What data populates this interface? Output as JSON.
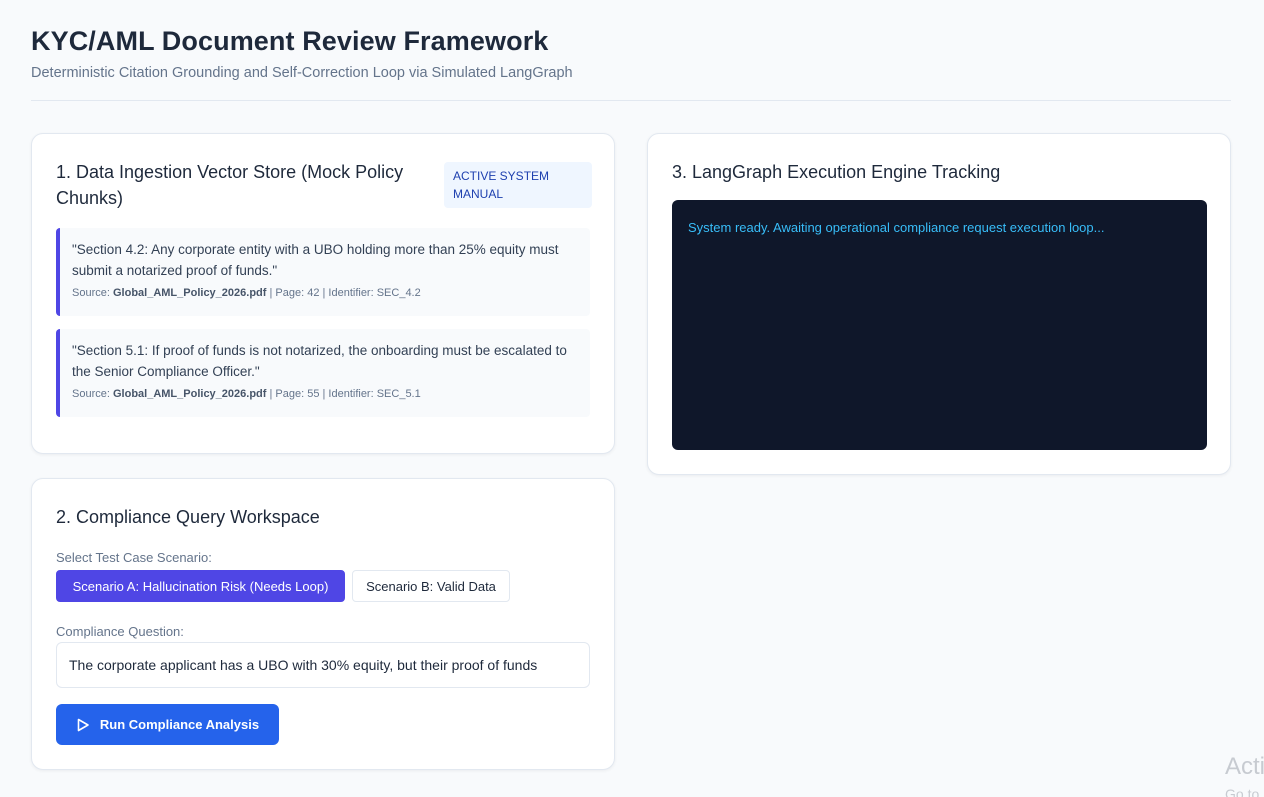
{
  "header": {
    "title": "KYC/AML Document Review Framework",
    "subtitle": "Deterministic Citation Grounding and Self-Correction Loop via Simulated LangGraph"
  },
  "ingestion": {
    "title": "1. Data Ingestion Vector Store (Mock Policy Chunks)",
    "badge": "ACTIVE SYSTEM MANUAL",
    "chunks": [
      {
        "text": "\"Section 4.2: Any corporate entity with a UBO holding more than 25% equity must submit a notarized proof of funds.\"",
        "source_label": "Source:",
        "file": "Global_AML_Policy_2026.pdf",
        "meta": "| Page: 42 | Identifier: SEC_4.2"
      },
      {
        "text": "\"Section 5.1: If proof of funds is not notarized, the onboarding must be escalated to the Senior Compliance Officer.\"",
        "source_label": "Source:",
        "file": "Global_AML_Policy_2026.pdf",
        "meta": "| Page: 55 | Identifier: SEC_5.1"
      }
    ]
  },
  "query": {
    "title": "2. Compliance Query Workspace",
    "scenario_label": "Select Test Case Scenario:",
    "scenario_a": "Scenario A: Hallucination Risk (Needs Loop)",
    "scenario_b": "Scenario B: Valid Data",
    "question_label": "Compliance Question:",
    "question_value": "The corporate applicant has a UBO with 30% equity, but their proof of funds",
    "run_label": "Run Compliance Analysis"
  },
  "engine": {
    "title": "3. LangGraph Execution Engine Tracking",
    "console_text": "System ready. Awaiting operational compliance request execution loop..."
  },
  "watermark": {
    "line1": "Acti",
    "line2": "Go to"
  },
  "colors": {
    "accent": "#4f46e5",
    "primary_button": "#2563eb",
    "console_bg": "#0f172a",
    "console_text": "#38bdf8"
  }
}
